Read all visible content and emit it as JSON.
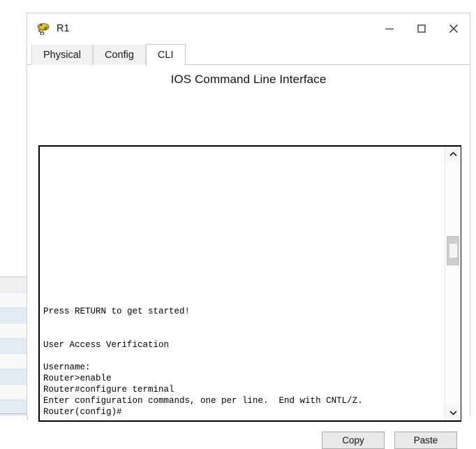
{
  "window": {
    "title": "R1",
    "icon": "router-icon",
    "controls": {
      "minimize": "minimize-icon",
      "maximize": "maximize-icon",
      "close": "close-icon"
    }
  },
  "tabs": [
    {
      "label": "Physical",
      "active": false
    },
    {
      "label": "Config",
      "active": false
    },
    {
      "label": "CLI",
      "active": true
    }
  ],
  "panel": {
    "heading": "IOS Command Line Interface"
  },
  "terminal": {
    "lines": [
      "Press RETURN to get started!",
      "",
      "",
      "User Access Verification",
      "",
      "Username:",
      "Router>enable",
      "Router#configure terminal",
      "Enter configuration commands, one per line.  End with CNTL/Z.",
      "Router(config)#"
    ],
    "scrollbar": {
      "up_arrow": "chevron-up-icon",
      "down_arrow": "chevron-down-icon",
      "thumb_position_pct": 30
    }
  },
  "buttons": {
    "copy": "Copy",
    "paste": "Paste"
  },
  "colors": {
    "window_bg": "#f5f5f5",
    "panel_bg": "#ffffff",
    "terminal_border": "#000000",
    "button_bg": "#e8e8e8",
    "text": "#141414"
  }
}
